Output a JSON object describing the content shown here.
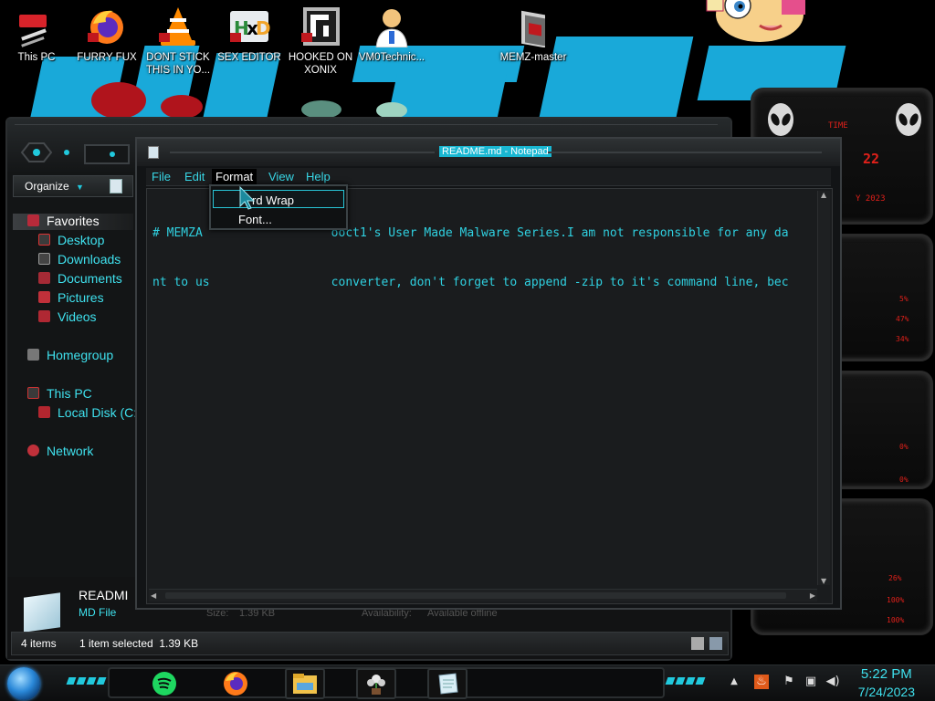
{
  "desktop": {
    "icons": [
      {
        "label": "This PC",
        "icon": "computer-icon"
      },
      {
        "label": "FURRY FUX",
        "icon": "firefox-icon"
      },
      {
        "label": "DONT STICK THIS IN YO...",
        "icon": "vlc-icon"
      },
      {
        "label": "SEX EDITOR",
        "icon": "hxd-icon"
      },
      {
        "label": "HOOKED ON XONIX",
        "icon": "xonix-icon"
      },
      {
        "label": "VM0Technic...",
        "icon": "doctor-icon"
      },
      {
        "label": "MEMZ-master",
        "icon": "folder-icon"
      }
    ]
  },
  "explorer": {
    "organize_label": "Organize",
    "nav": {
      "favorites": "Favorites",
      "desktop": "Desktop",
      "downloads": "Downloads",
      "documents": "Documents",
      "pictures": "Pictures",
      "videos": "Videos",
      "homegroup": "Homegroup",
      "this_pc": "This PC",
      "local_disk": "Local Disk (C:",
      "network": "Network"
    },
    "details": {
      "name": "READMI",
      "type": "MD File",
      "size_label": "Size:",
      "size_value": "1.39 KB",
      "availability_label": "Availability:",
      "availability_value": "Available offline"
    },
    "status": {
      "items": "4 items",
      "selected": "1 item selected  1.39 KB"
    }
  },
  "notepad": {
    "title": "README.md - Notepad",
    "menu": [
      "File",
      "Edit",
      "Format",
      "View",
      "Help"
    ],
    "active_menu": "Format",
    "text_lines": [
      "# MEMZA                  ooct1's User Made Malware Series.I am not responsible for any da",
      "nt to us                 converter, don't forget to append -zip to it's command line, bec"
    ]
  },
  "format_menu": {
    "items": [
      "Word Wrap",
      "Font..."
    ],
    "visible_word_wrap": "rd Wrap",
    "hover_item": "Word Wrap"
  },
  "gadget": {
    "time_label": "TIME",
    "time_value": "22",
    "date_value": "Y 2023",
    "cpu": [
      "5%",
      "47%",
      "34%"
    ],
    "bars": [
      "0%",
      "0%",
      "26%",
      "100%",
      "100%"
    ]
  },
  "taskbar": {
    "time": "5:22 PM",
    "date": "7/24/2023",
    "apps": [
      "spotify-icon",
      "firefox-icon",
      "file-explorer-icon",
      "plant-app-icon",
      "notepad-icon"
    ],
    "tray": [
      "show-hidden-icon",
      "fire-icon",
      "network-off-icon",
      "monitor-icon",
      "volume-icon"
    ]
  },
  "colors": {
    "accent_cyan": "#21c9dd",
    "text_cyan": "#38d7e6",
    "alert_red": "#e0201a",
    "title_highlight": "#19b7d2"
  }
}
